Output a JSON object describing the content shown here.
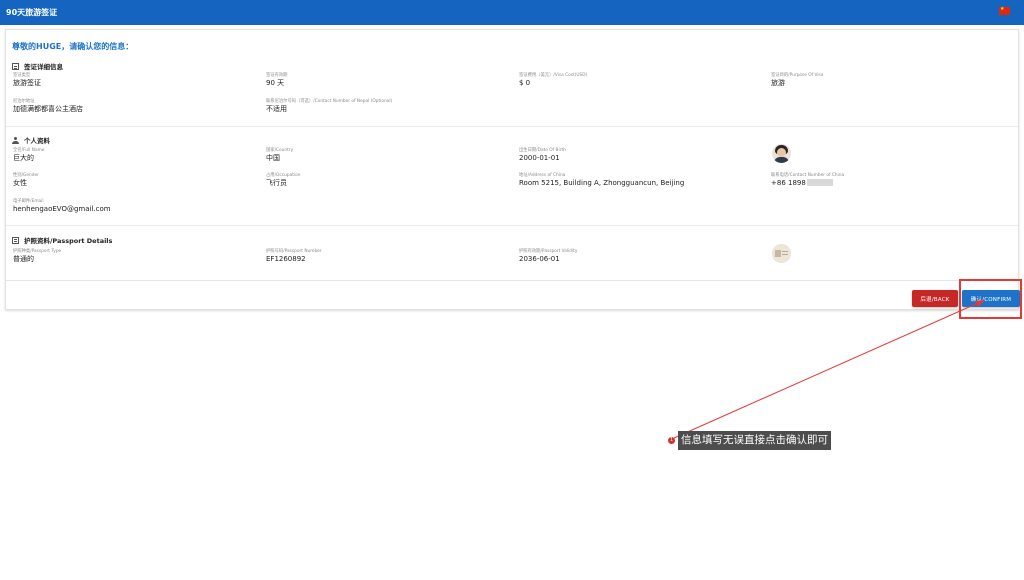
{
  "header": {
    "title": "90天旅游签证",
    "flag_icon": "china-flag-icon",
    "brand_color": "#1565c0"
  },
  "greeting": "尊敬的HUGE，请确认您的信息：",
  "visa_section": {
    "title": "签证详细信息",
    "fields": [
      {
        "label": "签证类型",
        "value": "旅游签证"
      },
      {
        "label": "签证有效期",
        "value": "90 天"
      },
      {
        "label": "签证费用（美元）/Visa Cost(USD)",
        "value": "$ 0"
      },
      {
        "label": "签证目的/Purpose Of Visa",
        "value": "旅游"
      },
      {
        "label": "尼泊尔地址",
        "value": "加德满都都喜公主酒店"
      },
      {
        "label": "联系尼泊尔号码（可选）/Contact Number of Nepal (Optional)",
        "value": "不适用"
      }
    ]
  },
  "personal_section": {
    "title": "个人资料",
    "fields": [
      {
        "label": "全名/Full Name",
        "value": "巨大的"
      },
      {
        "label": "国家/Country",
        "value": "中国"
      },
      {
        "label": "出生日期/Date Of Birth",
        "value": "2000-01-01"
      },
      {
        "label": "性别/Gender",
        "value": "女性"
      },
      {
        "label": "占用/Occupation",
        "value": "飞行员"
      },
      {
        "label": "地址/Address of China",
        "value": "Room 5215, Building A, Zhongguancun, Beijing"
      },
      {
        "label": "联系电话/Contact Number of China",
        "value": "+86 1898"
      },
      {
        "label": "电子邮件/Email",
        "value": "henhengaoEVO@gmail.com"
      }
    ]
  },
  "passport_section": {
    "title": "护照资料/Passport Details",
    "fields": [
      {
        "label": "护照种类/Passport Type",
        "value": "普通的"
      },
      {
        "label": "护照号码/Passport Number",
        "value": "EF1260892"
      },
      {
        "label": "护照有效期/Passport Validity",
        "value": "2036-06-01"
      }
    ]
  },
  "actions": {
    "back_label": "后退/BACK",
    "confirm_label": "确认/CONFIRM",
    "back_color": "#c62828",
    "confirm_color": "#1e73c8"
  },
  "annotation": {
    "number": "1",
    "text": "信息填写无误直接点击确认即可",
    "color": "#e53935"
  }
}
